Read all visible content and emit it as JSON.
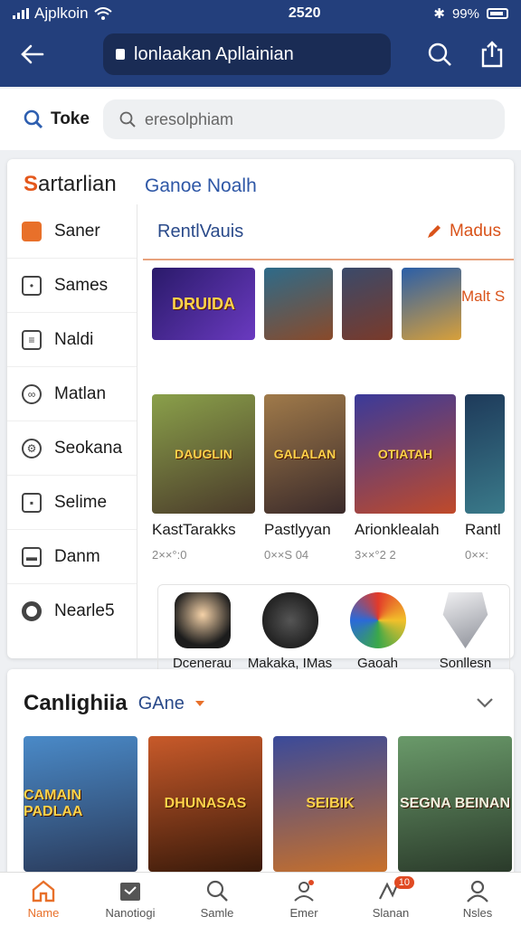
{
  "status": {
    "carrier": "Ajplkoin",
    "time": "2520",
    "battery": "99%"
  },
  "appbar": {
    "title": "lonlaakan Apllainian"
  },
  "search": {
    "tag": "Toke",
    "placeholder": "eresolphiam"
  },
  "card": {
    "title_accent": "S",
    "title_rest": "artarlian",
    "subtitle": "Ganoe Noalh",
    "sidebar": [
      {
        "label": "Saner",
        "icon": "home-icon"
      },
      {
        "label": "Sames",
        "icon": "square-icon"
      },
      {
        "label": "Naldi",
        "icon": "calendar-icon"
      },
      {
        "label": "Matlan",
        "icon": "link-icon"
      },
      {
        "label": "Seokana",
        "icon": "gear-icon"
      },
      {
        "label": "Selime",
        "icon": "box-icon"
      },
      {
        "label": "Danm",
        "icon": "tray-icon"
      },
      {
        "label": "Nearle5",
        "icon": "circle-icon"
      }
    ],
    "pane_title": "RentlVauis",
    "pane_more": "Madus",
    "banner_more": "Malt S",
    "banners": [
      {
        "text": "DRUIDA",
        "color": "#4a2c8f"
      },
      {
        "text": "",
        "color": "#2d6b8a"
      },
      {
        "text": "",
        "color": "#3a4a6a"
      },
      {
        "text": "",
        "color": "#2a5ea8"
      }
    ],
    "games": [
      {
        "name": "KastTarakks",
        "meta": "2××°:0",
        "art": "DAUGLIN",
        "color": "#6a7a3a"
      },
      {
        "name": "Pastlyyan",
        "meta": "0××S 04",
        "art": "GALALAN",
        "color": "#7a5a3a"
      },
      {
        "name": "Arionklealah",
        "meta": "3××°2 2",
        "art": "OTIATAH",
        "color": "#5a2a7a"
      },
      {
        "name": "Rantl",
        "meta": "0××:",
        "art": "",
        "color": "#1e3a5a"
      }
    ],
    "apps": [
      {
        "label": "Dcenerau",
        "color": "#f1d7b6"
      },
      {
        "label": "Makaka, IMas",
        "color": "#3a3a3a"
      },
      {
        "label": "Gaoah",
        "color": "#6bb84a"
      },
      {
        "label": "Sonllesn",
        "color": "#cfd2d8"
      }
    ]
  },
  "section2": {
    "title": "Canlighiia",
    "subtitle": "GAne",
    "games": [
      {
        "art": "CAMAIN PADLAA",
        "color": "#2b5c8f"
      },
      {
        "art": "DHUNASAS",
        "color": "#8a3a1a"
      },
      {
        "art": "SEIBIK",
        "color": "#4a2a6a"
      },
      {
        "art": "SEGNA BEINAN",
        "color": "#3a6a3a"
      }
    ]
  },
  "bottomnav": [
    {
      "label": "Name",
      "icon": "home-icon",
      "active": true
    },
    {
      "label": "Nanotiogi",
      "icon": "grid-icon",
      "active": false
    },
    {
      "label": "Samle",
      "icon": "search-icon",
      "active": false
    },
    {
      "label": "Emer",
      "icon": "user-icon",
      "active": false
    },
    {
      "label": "Slanan",
      "icon": "activity-icon",
      "active": false,
      "badge": "10"
    },
    {
      "label": "Nsles",
      "icon": "profile-icon",
      "active": false
    }
  ],
  "colors": {
    "brand": "#233f7c",
    "accent": "#e8702a",
    "link": "#2a4a8a"
  }
}
